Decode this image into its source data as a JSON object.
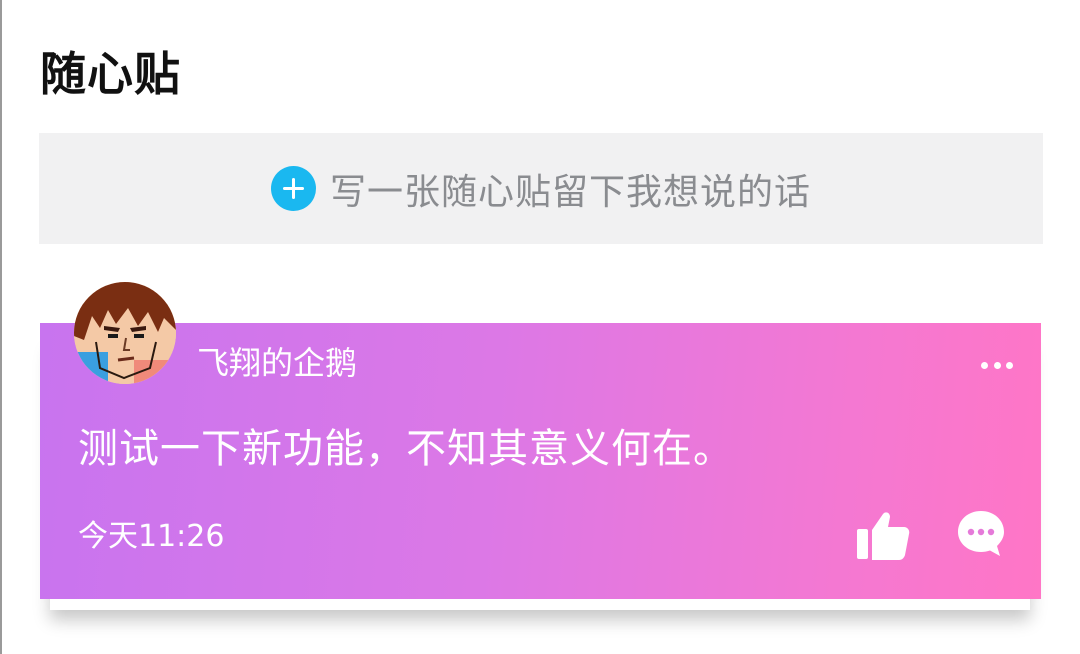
{
  "page": {
    "title": "随心贴"
  },
  "compose": {
    "icon": "plus-circle-icon",
    "placeholder": "写一张随心贴留下我想说的话",
    "icon_color": "#1ab8f0"
  },
  "post": {
    "user_name": "飞翔的企鹅",
    "content": "测试一下新功能，不知其意义何在。",
    "time": "今天11:26",
    "avatar": "user-avatar",
    "more_icon": "more-dots-icon",
    "like_icon": "thumbs-up-icon",
    "comment_icon": "comment-bubble-icon",
    "gradient_colors": [
      "#c874ef",
      "#ff76c6"
    ]
  }
}
